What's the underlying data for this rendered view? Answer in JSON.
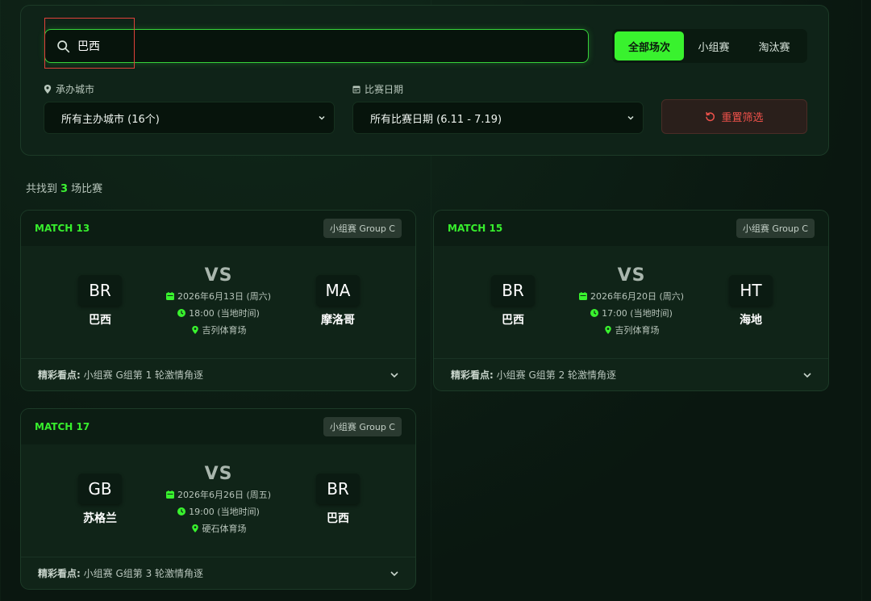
{
  "search": {
    "value": "巴西",
    "placeholder": ""
  },
  "stage_tabs": [
    {
      "label": "全部场次",
      "active": true
    },
    {
      "label": "小组赛",
      "active": false
    },
    {
      "label": "淘汰赛",
      "active": false
    }
  ],
  "filters": {
    "city_label": "承办城市",
    "city_value": "所有主办城市 (16个)",
    "date_label": "比赛日期",
    "date_value": "所有比赛日期 (6.11 - 7.19)",
    "reset_label": "重置筛选"
  },
  "results": {
    "prefix": "共找到",
    "count": "3",
    "suffix": "场比赛"
  },
  "matches": [
    {
      "match_no": "MATCH 13",
      "group": "小组赛 Group C",
      "home": {
        "code": "BR",
        "name": "巴西"
      },
      "away": {
        "code": "MA",
        "name": "摩洛哥"
      },
      "vs": "VS",
      "date": "2026年6月13日 (周六)",
      "time": "18:00 (当地时间)",
      "venue": "吉列体育场",
      "highlight_label": "精彩看点:",
      "highlight": "小组赛 G组第 1 轮激情角逐"
    },
    {
      "match_no": "MATCH 15",
      "group": "小组赛 Group C",
      "home": {
        "code": "BR",
        "name": "巴西"
      },
      "away": {
        "code": "HT",
        "name": "海地"
      },
      "vs": "VS",
      "date": "2026年6月20日 (周六)",
      "time": "17:00 (当地时间)",
      "venue": "吉列体育场",
      "highlight_label": "精彩看点:",
      "highlight": "小组赛 G组第 2 轮激情角逐"
    },
    {
      "match_no": "MATCH 17",
      "group": "小组赛 Group C",
      "home": {
        "code": "GB",
        "name": "苏格兰"
      },
      "away": {
        "code": "BR",
        "name": "巴西"
      },
      "vs": "VS",
      "date": "2026年6月26日 (周五)",
      "time": "19:00 (当地时间)",
      "venue": "硬石体育场",
      "highlight_label": "精彩看点:",
      "highlight": "小组赛 G组第 3 轮激情角逐"
    }
  ],
  "colors": {
    "accent": "#39f22e",
    "danger": "#f0524b",
    "panel": "#0f2318"
  },
  "icons": [
    "search-icon",
    "location-pin-icon",
    "calendar-icon",
    "chevron-down-icon",
    "reset-icon",
    "clock-icon"
  ]
}
